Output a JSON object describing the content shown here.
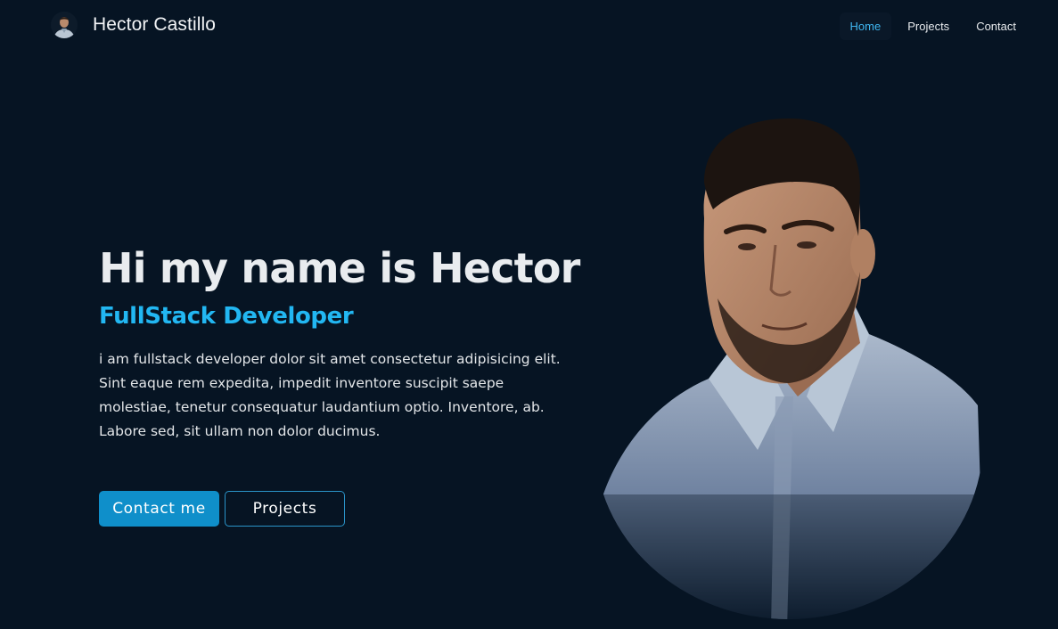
{
  "navbar": {
    "brand_name": "Hector Castillo",
    "items": [
      {
        "label": "Home",
        "active": true
      },
      {
        "label": "Projects",
        "active": false
      },
      {
        "label": "Contact",
        "active": false
      }
    ]
  },
  "hero": {
    "title": "Hi my name is Hector",
    "role": "FullStack Developer",
    "description": "i am fullstack developer dolor sit amet consectetur adipisicing elit. Sint eaque rem expedita, impedit inventore suscipit saepe molestiae, tenetur consequatur laudantium optio. Inventore, ab. Labore sed, sit ullam non dolor ducimus.",
    "buttons": {
      "contact_label": "Contact me",
      "projects_label": "Projects"
    }
  },
  "colors": {
    "background": "#061423",
    "accent": "#22b7f2",
    "primary_button": "#0f8fca",
    "text": "#e9ecef"
  }
}
